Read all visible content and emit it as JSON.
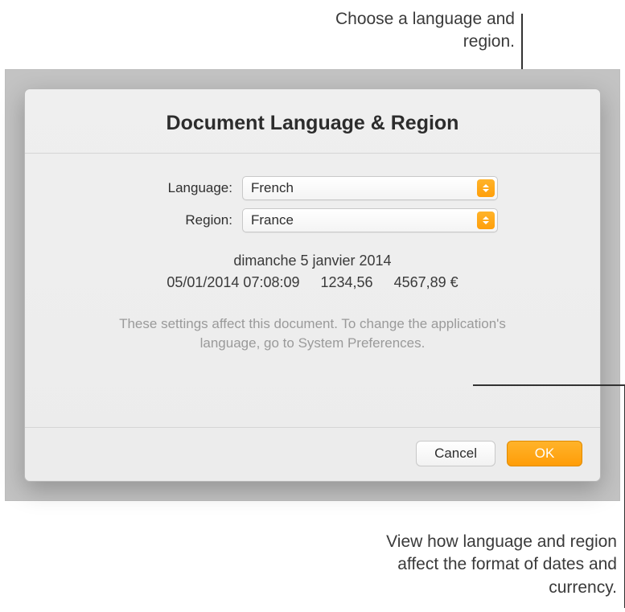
{
  "callouts": {
    "top": "Choose a language and region.",
    "bottom": "View how language and region affect the format of dates and currency."
  },
  "dialog": {
    "title": "Document Language & Region",
    "form": {
      "language_label": "Language:",
      "language_value": "French",
      "region_label": "Region:",
      "region_value": "France"
    },
    "preview": {
      "long_date": "dimanche 5 janvier 2014",
      "datetime": "05/01/2014 07:08:09",
      "number": "1234,56",
      "currency": "4567,89 €"
    },
    "helper_text": "These settings affect this document. To change the application's language, go to System Preferences.",
    "buttons": {
      "cancel": "Cancel",
      "ok": "OK"
    }
  }
}
